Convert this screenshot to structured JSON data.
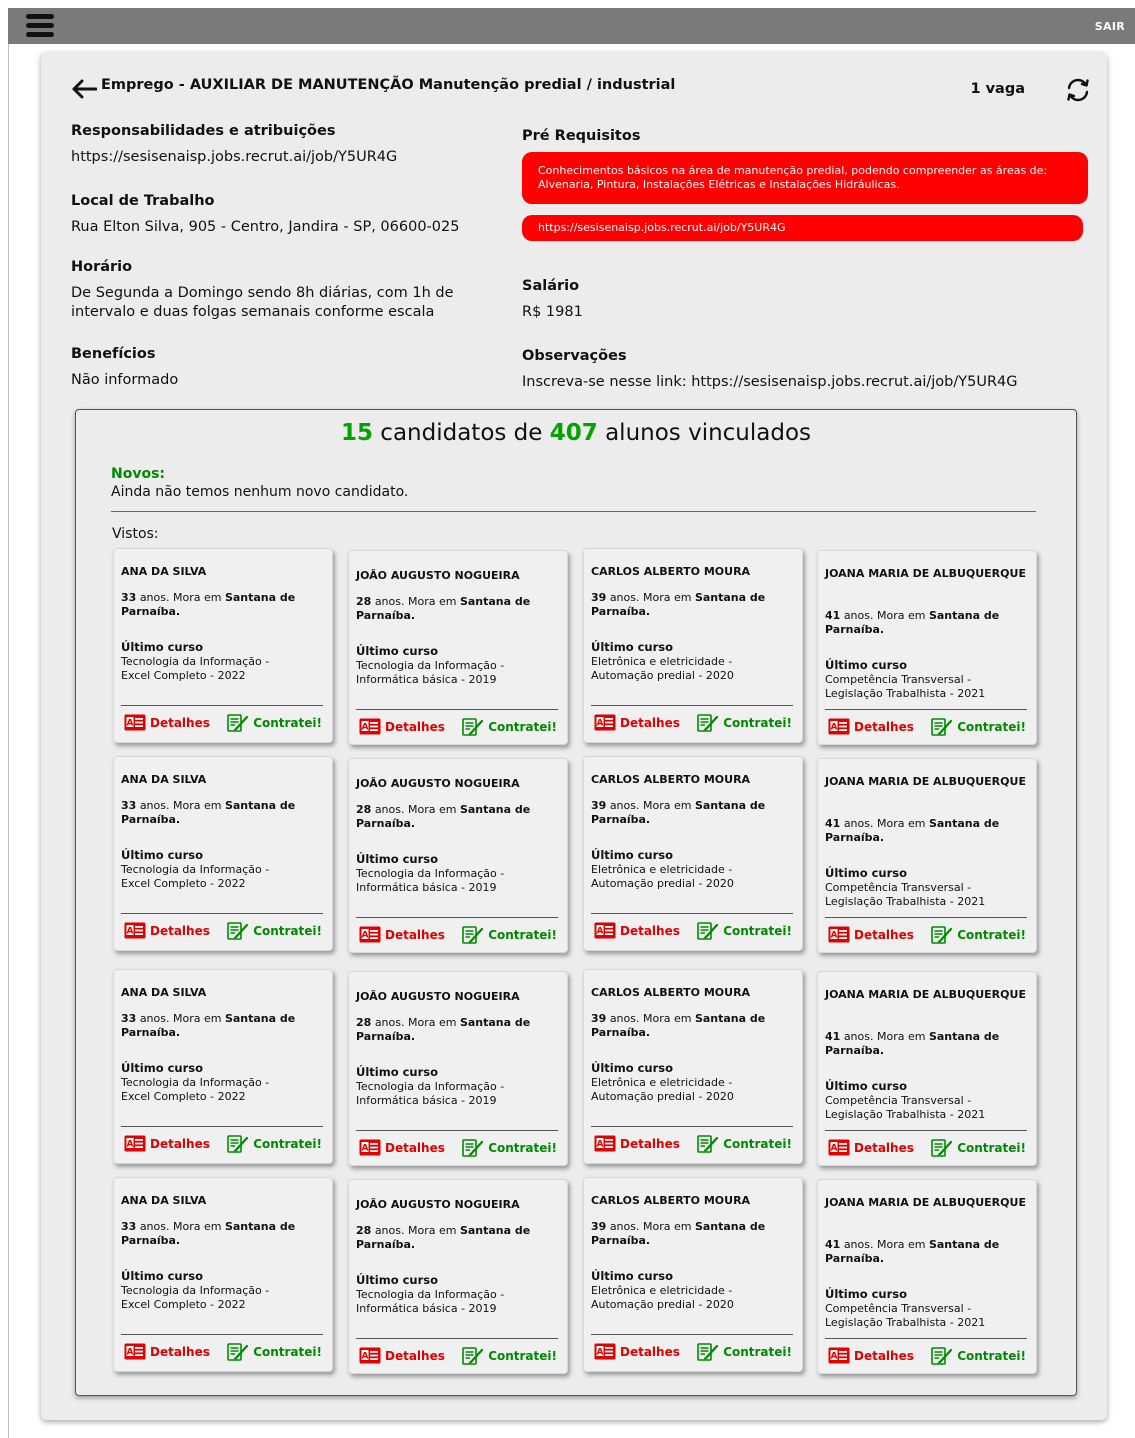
{
  "topbar": {
    "logout_label": "SAIR"
  },
  "job": {
    "title": "Emprego - AUXILIAR DE MANUTENÇÃO Manutenção predial / industrial",
    "vacancies": "1 vaga",
    "responsibilities": {
      "label": "Responsabilidades e atribuições",
      "value": "https://sesisenaisp.jobs.recrut.ai/job/Y5UR4G"
    },
    "location": {
      "label": "Local de Trabalho",
      "value": "Rua Elton Silva, 905 - Centro, Jandira - SP, 06600-025"
    },
    "schedule": {
      "label": "Horário",
      "value": "De Segunda a Domingo sendo 8h diárias, com 1h de intervalo e duas folgas semanais conforme escala"
    },
    "benefits": {
      "label": "Benefícios",
      "value": "Não informado"
    },
    "prerequisites": {
      "label": "Pré Requisitos",
      "items": [
        "Conhecimentos básicos na área de manutenção predial, podendo compreender as áreas de: Alvenaria, Pintura, Instalações Elétricas e Instalações Hidráulicas.",
        "https://sesisenaisp.jobs.recrut.ai/job/Y5UR4G"
      ]
    },
    "salary": {
      "label": "Salário",
      "value": "R$ 1981"
    },
    "notes": {
      "label": "Observações",
      "value": "Inscreva-se nesse link: https://sesisenaisp.jobs.recrut.ai/job/Y5UR4G"
    }
  },
  "candidates": {
    "count": "15",
    "mid_text": "candidatos de",
    "total": "407",
    "end_text": "alunos vinculados",
    "new_label": "Novos:",
    "new_empty": "Ainda não temos nenhum novo candidato.",
    "seen_label": "Vistos:",
    "detail_label": "Detalhes",
    "hire_label": "Contratei!",
    "age_mid": "anos. Mora em",
    "course_label": "Último curso",
    "cards": [
      {
        "name": "ANA DA SILVA",
        "age": "33",
        "city": "Santana de Parnaíba.",
        "course": "Tecnologia da Informação - Excel Completo - 2022"
      },
      {
        "name": "JOÃO AUGUSTO NOGUEIRA",
        "age": "28",
        "city": "Santana de Parnaíba.",
        "course": "Tecnologia da Informação - Informática básica - 2019"
      },
      {
        "name": "CARLOS ALBERTO MOURA",
        "age": "39",
        "city": "Santana de Parnaíba.",
        "course": "Eletrônica e eletricidade - Automação predial - 2020"
      },
      {
        "name": "JOANA MARIA DE ALBUQUERQUE",
        "age": "41",
        "city": "Santana de Parnaíba.",
        "course": "Competência Transversal - Legislação Trabalhista - 2021"
      }
    ]
  },
  "colors": {
    "accent_green": "#00a300",
    "accent_red": "#ff0000",
    "topbar": "#7a7a7a"
  }
}
